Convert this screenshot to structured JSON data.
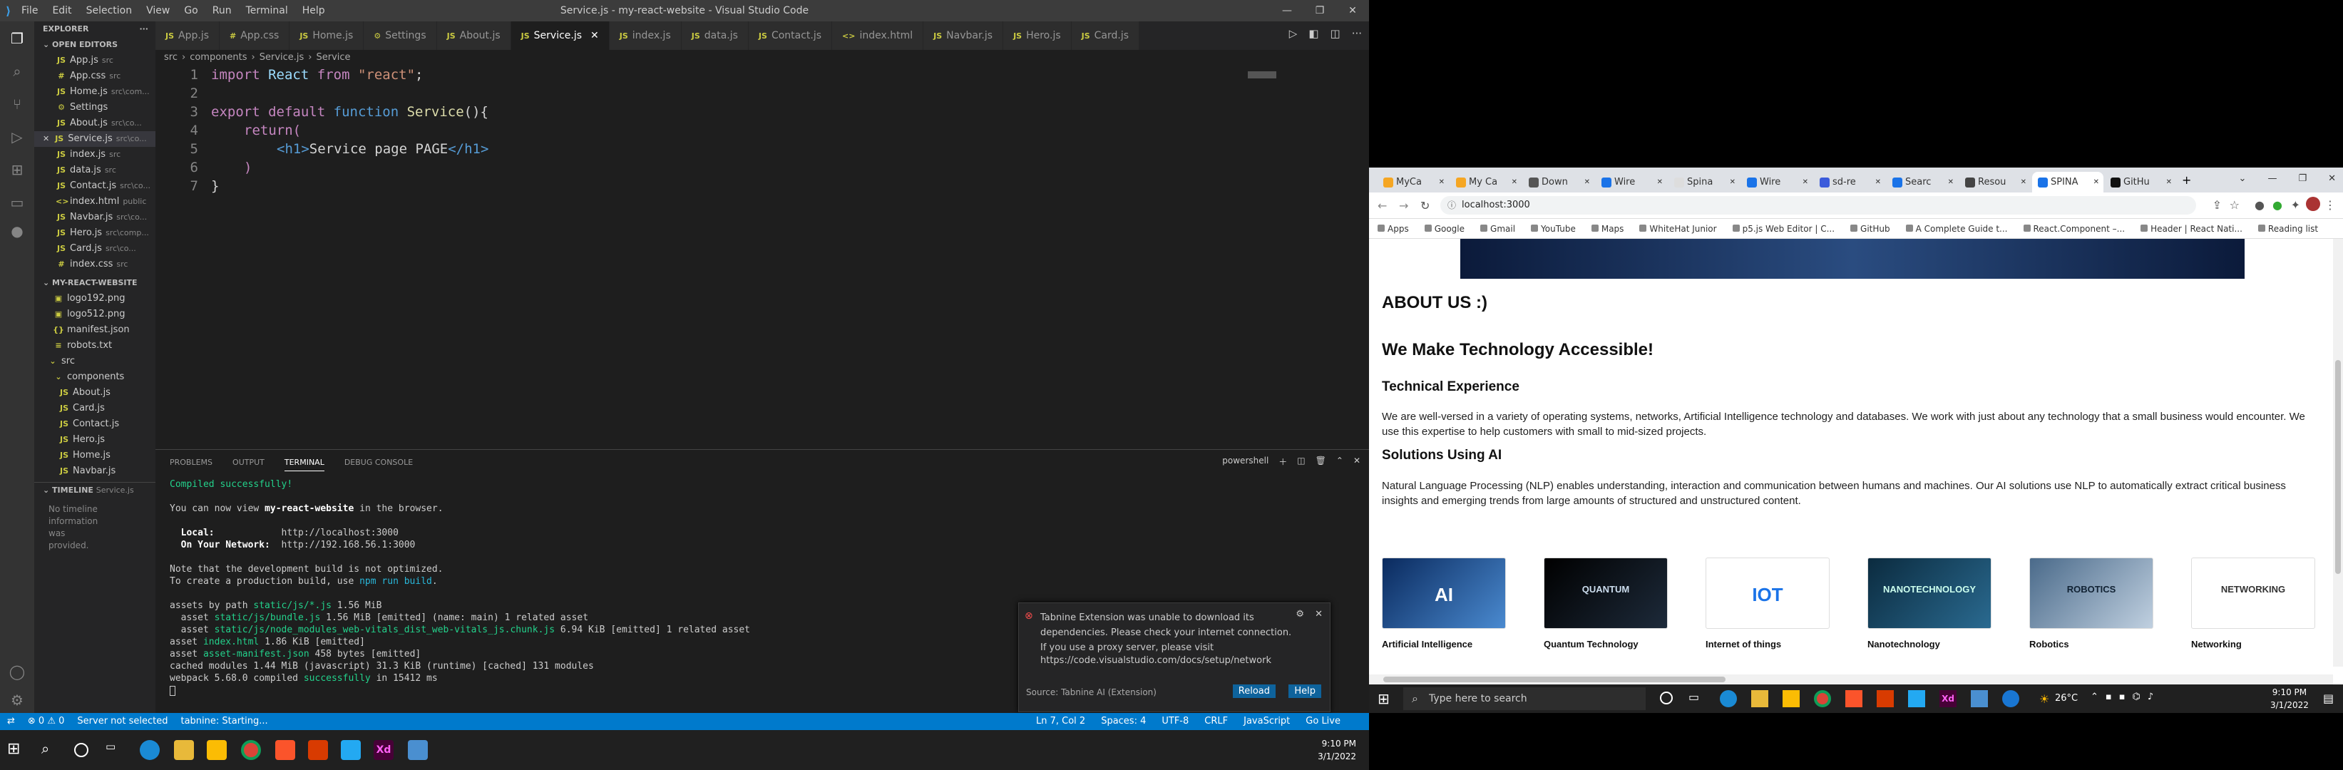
{
  "vscode": {
    "window_title": "Service.js - my-react-website - Visual Studio Code",
    "menu": [
      "File",
      "Edit",
      "Selection",
      "View",
      "Go",
      "Run",
      "Terminal",
      "Help"
    ],
    "explorer": {
      "header": "EXPLORER",
      "open_editors_label": "OPEN EDITORS",
      "open_editors": [
        {
          "name": "App.js",
          "path": "src",
          "icon": "JS"
        },
        {
          "name": "App.css",
          "path": "src",
          "icon": "#"
        },
        {
          "name": "Home.js",
          "path": "src\\com...",
          "icon": "JS"
        },
        {
          "name": "Settings",
          "path": "",
          "icon": "⚙"
        },
        {
          "name": "About.js",
          "path": "src\\co...",
          "icon": "JS"
        },
        {
          "name": "Service.js",
          "path": "src\\co...",
          "icon": "JS"
        },
        {
          "name": "index.js",
          "path": "src",
          "icon": "JS"
        },
        {
          "name": "data.js",
          "path": "src",
          "icon": "JS"
        },
        {
          "name": "Contact.js",
          "path": "src\\co...",
          "icon": "JS"
        },
        {
          "name": "index.html",
          "path": "public",
          "icon": "<>"
        },
        {
          "name": "Navbar.js",
          "path": "src\\co...",
          "icon": "JS"
        },
        {
          "name": "Hero.js",
          "path": "src\\comp...",
          "icon": "JS"
        },
        {
          "name": "Card.js",
          "path": "src\\co...",
          "icon": "JS"
        },
        {
          "name": "index.css",
          "path": "src",
          "icon": "#"
        }
      ],
      "project_label": "MY-REACT-WEBSITE",
      "tree": [
        {
          "name": "logo192.png",
          "indent": 1,
          "icon": "▣"
        },
        {
          "name": "logo512.png",
          "indent": 1,
          "icon": "▣"
        },
        {
          "name": "manifest.json",
          "indent": 1,
          "icon": "{}"
        },
        {
          "name": "robots.txt",
          "indent": 1,
          "icon": "≡"
        },
        {
          "name": "src",
          "indent": 0,
          "icon": "⌄"
        },
        {
          "name": "components",
          "indent": 1,
          "icon": "⌄"
        },
        {
          "name": "About.js",
          "indent": 2,
          "icon": "JS"
        },
        {
          "name": "Card.js",
          "indent": 2,
          "icon": "JS"
        },
        {
          "name": "Contact.js",
          "indent": 2,
          "icon": "JS"
        },
        {
          "name": "Hero.js",
          "indent": 2,
          "icon": "JS"
        },
        {
          "name": "Home.js",
          "indent": 2,
          "icon": "JS"
        },
        {
          "name": "Navbar.js",
          "indent": 2,
          "icon": "JS"
        }
      ],
      "timeline_label": "TIMELINE",
      "timeline_file": "Service.js",
      "timeline_empty": "No timeline information was provided."
    },
    "tabs": [
      "App.js",
      "App.css",
      "Home.js",
      "Settings",
      "About.js",
      "Service.js",
      "index.js",
      "data.js",
      "Contact.js",
      "index.html",
      "Navbar.js",
      "Hero.js",
      "Card.js"
    ],
    "active_tab": "Service.js",
    "breadcrumb": [
      "src",
      "components",
      "Service.js",
      "Service"
    ],
    "code_lines": [
      "1",
      "2",
      "3",
      "4",
      "5",
      "6",
      "7"
    ],
    "code": {
      "l1_import": "import",
      "l1_name": "React",
      "l1_from": "from",
      "l1_str": "\"react\"",
      "l1_semi": ";",
      "l3_export": "export",
      "l3_default": "default",
      "l3_function": "function",
      "l3_name": "Service",
      "l3_rest": "(){",
      "l4_return": "return(",
      "l5_open": "<h1>",
      "l5_text": "Service page PAGE",
      "l5_close": "</h1>",
      "l6": ")",
      "l7": "}"
    },
    "panel_tabs": [
      "PROBLEMS",
      "OUTPUT",
      "TERMINAL",
      "DEBUG CONSOLE"
    ],
    "panel_shell": "powershell",
    "terminal": {
      "compiled": "Compiled successfully!",
      "view_pre": "You can now view ",
      "view_app": "my-react-website",
      "view_post": " in the browser.",
      "local_label": "Local:",
      "local_url": "http://localhost:3000",
      "network_label": "On Your Network:",
      "network_url": "http://192.168.56.1:3000",
      "note1": "Note that the development build is not optimized.",
      "note2_pre": "To create a production build, use ",
      "note2_cmd": "npm run build",
      "note2_post": ".",
      "assets_pre": "assets by path ",
      "assets_path": "static/js/*.js",
      "assets_size": " 1.56 MiB",
      "a1_pre": "  asset ",
      "a1_file": "static/js/bundle.js",
      "a1_post": " 1.56 MiB [emitted] (name: main) 1 related asset",
      "a2_pre": "  asset ",
      "a2_file": "static/js/node_modules_web-vitals_dist_web-vitals_js.chunk.js",
      "a2_post": " 6.94 KiB [emitted] 1 related asset",
      "a3_pre": "asset ",
      "a3_file": "index.html",
      "a3_post": " 1.86 KiB [emitted]",
      "a4_pre": "asset ",
      "a4_file": "asset-manifest.json",
      "a4_post": " 458 bytes [emitted]",
      "cached": "cached modules 1.44 MiB (javascript) 31.3 KiB (runtime) [cached] 131 modules",
      "wp_pre": "webpack 5.68.0 compiled ",
      "wp_ok": "successfully",
      "wp_post": " in 15412 ms"
    },
    "notification": {
      "message": "Tabnine Extension was unable to download its dependencies. Please check your internet connection. If you use a proxy server, please visit",
      "url": "https://code.visualstudio.com/docs/setup/network",
      "source": "Source: Tabnine AI (Extension)",
      "reload": "Reload",
      "help": "Help"
    },
    "status": {
      "errors": "⊗ 0 ⚠ 0",
      "server": "Server not selected",
      "tabnine": "tabnine: Starting...",
      "position": "Ln 7, Col 2",
      "spaces": "Spaces: 4",
      "encoding": "UTF-8",
      "eol": "CRLF",
      "language": "JavaScript",
      "golive": "Go Live"
    }
  },
  "taskbar_left": {
    "time": "9:10 PM",
    "date": "3/1/2022"
  },
  "browser": {
    "tabs": [
      "MyCa",
      "My Ca",
      "Down",
      "Wire",
      "Spina",
      "Wire",
      "sd-re",
      "Searc",
      "Resou",
      "SPINA",
      "GitHu"
    ],
    "active_tab_index": 9,
    "address": "localhost:3000",
    "bookmarks": [
      "Apps",
      "Google",
      "Gmail",
      "YouTube",
      "Maps",
      "WhiteHat Junior",
      "p5.js Web Editor | C...",
      "GitHub",
      "A Complete Guide t...",
      "React.Component –...",
      "Header | React Nati...",
      "Reading list"
    ],
    "page": {
      "about_heading": "ABOUT US :)",
      "headline": "We Make Technology Accessible!",
      "tech_heading": "Technical Experience",
      "tech_text": "We are well-versed in a variety of operating systems, networks, Artificial Intelligence technology and databases. We work with just about any technology that a small business would encounter. We use this expertise to help customers with small to mid-sized projects.",
      "ai_heading": "Solutions Using AI",
      "ai_text": "Natural Language Processing (NLP) enables understanding, interaction and communication between humans and machines. Our AI solutions use NLP to automatically extract critical business insights and emerging trends from large amounts of structured and unstructured content.",
      "cards": [
        {
          "label": "Artificial Intelligence",
          "img_text": "AI"
        },
        {
          "label": "Quantum Technology",
          "img_text": "QUANTUM"
        },
        {
          "label": "Internet of things",
          "img_text": "IOT"
        },
        {
          "label": "Nanotechnology",
          "img_text": "NANOTECHNOLOGY"
        },
        {
          "label": "Robotics",
          "img_text": "ROBOTICS"
        },
        {
          "label": "Networking",
          "img_text": "NETWORKING"
        }
      ]
    }
  },
  "taskbar_right": {
    "search_placeholder": "Type here to search",
    "weather": "26°C",
    "time": "9:10 PM",
    "date": "3/1/2022"
  }
}
